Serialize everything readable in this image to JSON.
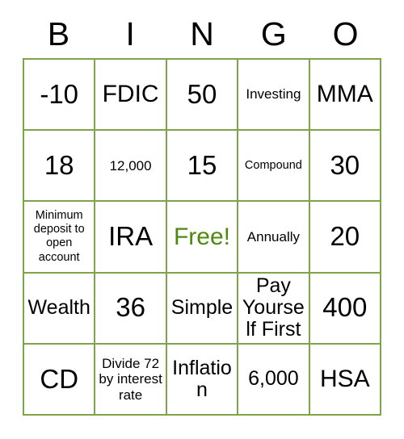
{
  "card": {
    "title": "Bingo Card",
    "header_letters": [
      "B",
      "I",
      "N",
      "G",
      "O"
    ],
    "border_color": "#7fa349",
    "free_space_color": "#4c8a0e",
    "text_color": "#000000",
    "background_color": "#ffffff",
    "grid_size": "5x5",
    "rows": [
      [
        {
          "text": "-10",
          "size": "xl",
          "free": false
        },
        {
          "text": "FDIC",
          "size": "lg",
          "free": false
        },
        {
          "text": "50",
          "size": "xl",
          "free": false
        },
        {
          "text": "Investing",
          "size": "sm",
          "free": false
        },
        {
          "text": "MMA",
          "size": "lg",
          "free": false
        }
      ],
      [
        {
          "text": "18",
          "size": "xl",
          "free": false
        },
        {
          "text": "12,000",
          "size": "sm",
          "free": false
        },
        {
          "text": "15",
          "size": "xl",
          "free": false
        },
        {
          "text": "Compound",
          "size": "xs",
          "free": false
        },
        {
          "text": "30",
          "size": "xl",
          "free": false
        }
      ],
      [
        {
          "text": "Minimum deposit to open account",
          "size": "xs",
          "free": false
        },
        {
          "text": "IRA",
          "size": "xl",
          "free": false
        },
        {
          "text": "Free!",
          "size": "lg",
          "free": true
        },
        {
          "text": "Annually",
          "size": "sm",
          "free": false
        },
        {
          "text": "20",
          "size": "xl",
          "free": false
        }
      ],
      [
        {
          "text": "Wealth",
          "size": "md",
          "free": false
        },
        {
          "text": "36",
          "size": "xl",
          "free": false
        },
        {
          "text": "Simple",
          "size": "md",
          "free": false
        },
        {
          "text": "Pay Yourself First",
          "size": "md",
          "free": false
        },
        {
          "text": "400",
          "size": "xl",
          "free": false
        }
      ],
      [
        {
          "text": "CD",
          "size": "xl",
          "free": false
        },
        {
          "text": "Divide 72 by interest rate",
          "size": "sm",
          "free": false
        },
        {
          "text": "Inflation",
          "size": "md",
          "free": false
        },
        {
          "text": "6,000",
          "size": "md",
          "free": false
        },
        {
          "text": "HSA",
          "size": "lg",
          "free": false
        }
      ]
    ]
  }
}
